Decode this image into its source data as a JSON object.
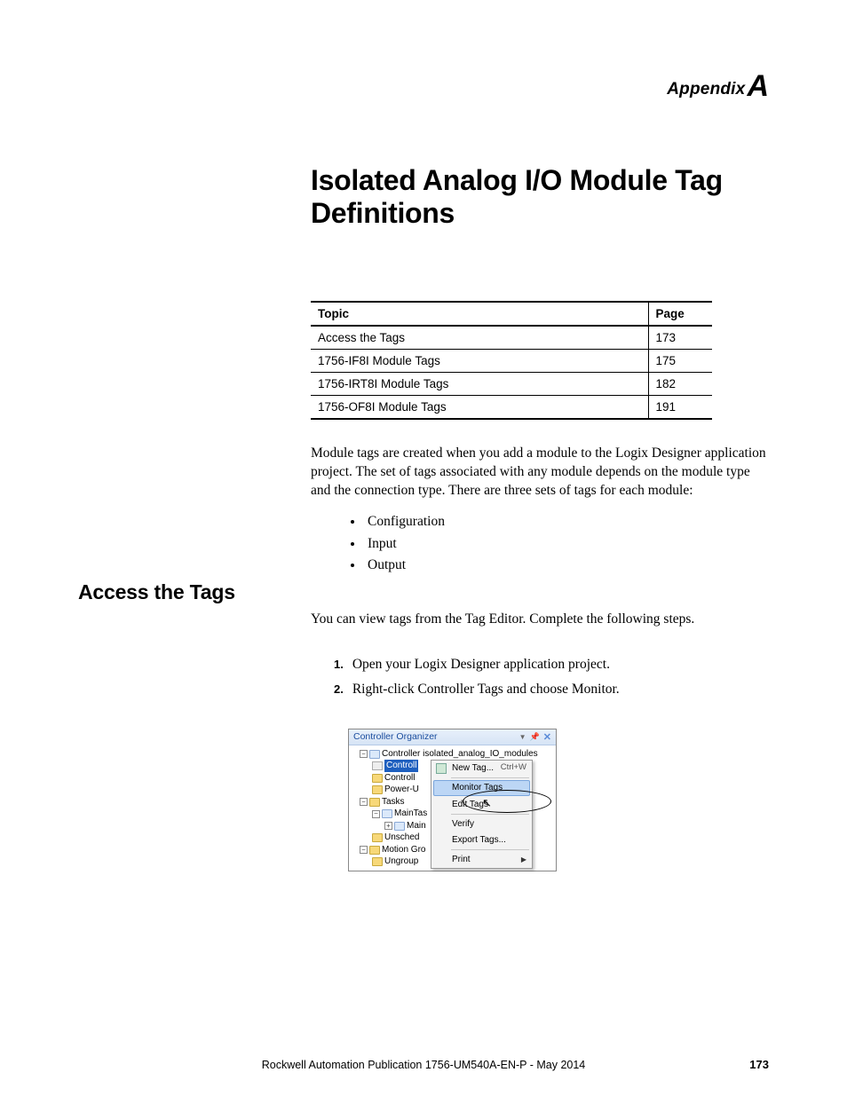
{
  "header": {
    "word": "Appendix",
    "letter": "A"
  },
  "title": "Isolated Analog I/O Module Tag Definitions",
  "toc": {
    "headers": {
      "topic": "Topic",
      "page": "Page"
    },
    "rows": [
      {
        "topic": "Access the Tags",
        "page": "173"
      },
      {
        "topic": "1756-IF8I Module Tags",
        "page": "175"
      },
      {
        "topic": "1756-IRT8I Module Tags",
        "page": "182"
      },
      {
        "topic": "1756-OF8I Module Tags",
        "page": "191"
      }
    ]
  },
  "intro": "Module tags are created when you add a module to the Logix Designer application project. The set of tags associated with any module depends on the module type and the connection type. There are three sets of tags for each module:",
  "tag_sets": [
    "Configuration",
    "Input",
    "Output"
  ],
  "section_heading": "Access the Tags",
  "section_intro": "You can view tags from the Tag Editor. Complete the following steps.",
  "steps": [
    {
      "n": "1.",
      "text": "Open your Logix Designer application project."
    },
    {
      "n": "2.",
      "text": "Right-click Controller Tags and choose Monitor."
    }
  ],
  "screenshot": {
    "panel_title": "Controller Organizer",
    "root": "Controller isolated_analog_IO_modules",
    "selected": "Controll",
    "nodes": {
      "controll2": "Controll",
      "powerU": "Power-U",
      "tasks": "Tasks",
      "mainTas": "MainTas",
      "main": "Main",
      "unsched": "Unsched",
      "motion": "Motion Gro",
      "ungroup": "Ungroup"
    },
    "menu": {
      "new": "New Tag...",
      "new_shortcut": "Ctrl+W",
      "monitor": "Monitor Tags",
      "edit": "Edit Tags",
      "verify": "Verify",
      "export": "Export Tags...",
      "print": "Print"
    }
  },
  "footer": "Rockwell Automation Publication 1756-UM540A-EN-P - May 2014",
  "page_number": "173"
}
